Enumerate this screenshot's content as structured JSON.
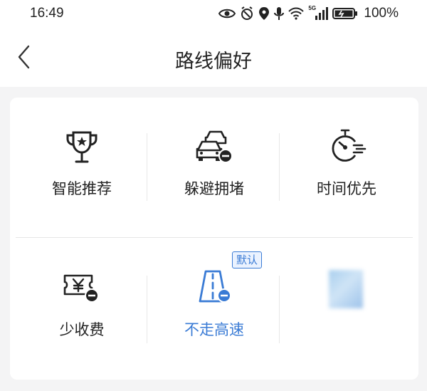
{
  "status_bar": {
    "time": "16:49",
    "network_label": "5G",
    "battery_percent": "100%"
  },
  "header": {
    "title": "路线偏好",
    "back_icon": "chevron-left-icon"
  },
  "options": [
    {
      "label": "智能推荐",
      "icon": "trophy-star-icon",
      "selected": false
    },
    {
      "label": "躲避拥堵",
      "icon": "cars-avoid-icon",
      "selected": false
    },
    {
      "label": "时间优先",
      "icon": "stopwatch-fast-icon",
      "selected": false
    },
    {
      "label": "少收费",
      "icon": "toll-ticket-avoid-icon",
      "selected": false
    },
    {
      "label": "不走高速",
      "icon": "highway-avoid-icon",
      "selected": true
    },
    {
      "label": "",
      "icon": "blurred-icon",
      "selected": false
    }
  ],
  "default_badge": "默认",
  "colors": {
    "accent": "#3a7bd5",
    "text": "#222222",
    "background": "#f4f4f5"
  }
}
